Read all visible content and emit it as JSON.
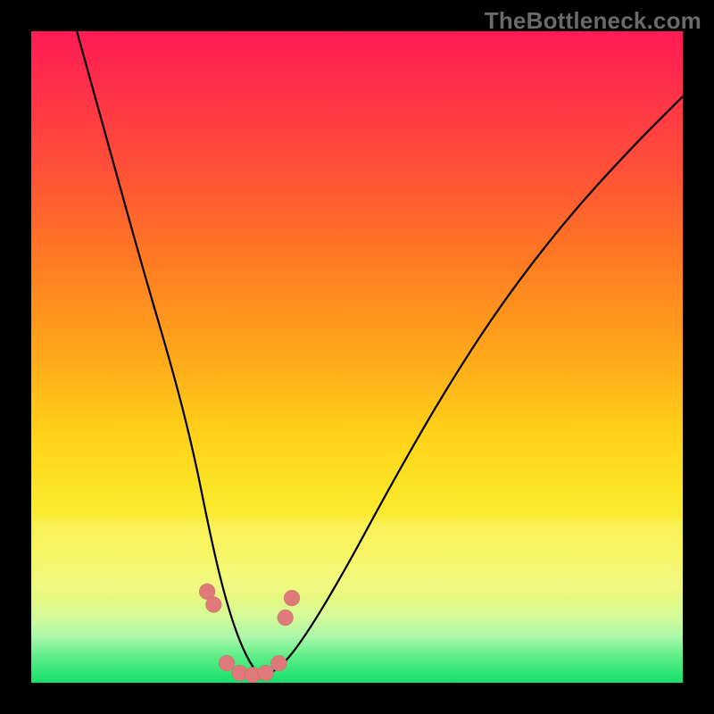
{
  "watermark": "TheBottleneck.com",
  "chart_data": {
    "type": "line",
    "title": "",
    "xlabel": "",
    "ylabel": "",
    "xlim": [
      0,
      100
    ],
    "ylim": [
      0,
      100
    ],
    "grid": false,
    "legend": false,
    "gradient_stops": [
      {
        "pos": 0,
        "color": "#ff1a54"
      },
      {
        "pos": 22,
        "color": "#ff5236"
      },
      {
        "pos": 48,
        "color": "#ffa21a"
      },
      {
        "pos": 72,
        "color": "#fbe82a"
      },
      {
        "pos": 90,
        "color": "#d4fa9a"
      },
      {
        "pos": 100,
        "color": "#14e06a"
      }
    ],
    "series": [
      {
        "name": "curve",
        "type": "line",
        "x": [
          7,
          12,
          17,
          22,
          25,
          27,
          29,
          31,
          33,
          35,
          38,
          42,
          48,
          55,
          63,
          72,
          82,
          92,
          100
        ],
        "y": [
          100,
          82,
          64,
          47,
          35,
          25,
          16,
          9,
          4,
          1,
          2,
          7,
          17,
          30,
          44,
          58,
          71,
          82,
          90
        ],
        "color": "#000000"
      },
      {
        "name": "markers",
        "type": "scatter",
        "x": [
          27,
          28,
          30,
          32,
          34,
          36,
          38,
          39,
          40
        ],
        "y": [
          14,
          12,
          3,
          1.5,
          1.2,
          1.5,
          3,
          10,
          13
        ],
        "color": "#e07a7a"
      }
    ],
    "note": "values estimated from pixel positions; axes have no labels in source image"
  }
}
